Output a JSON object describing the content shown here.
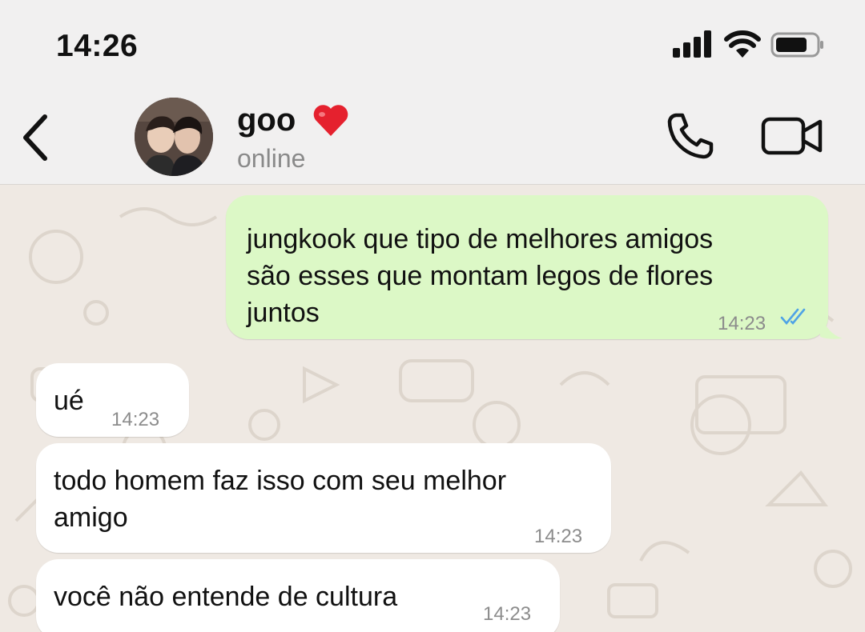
{
  "status_bar": {
    "time": "14:26"
  },
  "header": {
    "contact_name": "goo",
    "contact_status": "online",
    "icons": [
      "back-chevron-icon",
      "heart-emoji",
      "phone-icon",
      "video-camera-icon"
    ]
  },
  "colors": {
    "outgoing_bubble": "#dcf8c6",
    "incoming_bubble": "#ffffff",
    "read_ticks": "#4fa3e6",
    "wallpaper": "#efe9e3"
  },
  "messages": [
    {
      "direction": "outgoing",
      "lines": [
        "jungkook que tipo de melhores amigos",
        "são esses que montam legos de flores",
        "juntos"
      ],
      "time": "14:23",
      "status": "read"
    },
    {
      "direction": "incoming",
      "lines": [
        "ué"
      ],
      "time": "14:23"
    },
    {
      "direction": "incoming",
      "lines": [
        "todo homem faz isso com seu melhor",
        "amigo"
      ],
      "time": "14:23"
    },
    {
      "direction": "incoming",
      "lines": [
        "você não entende de cultura"
      ],
      "time": "14:23"
    }
  ]
}
